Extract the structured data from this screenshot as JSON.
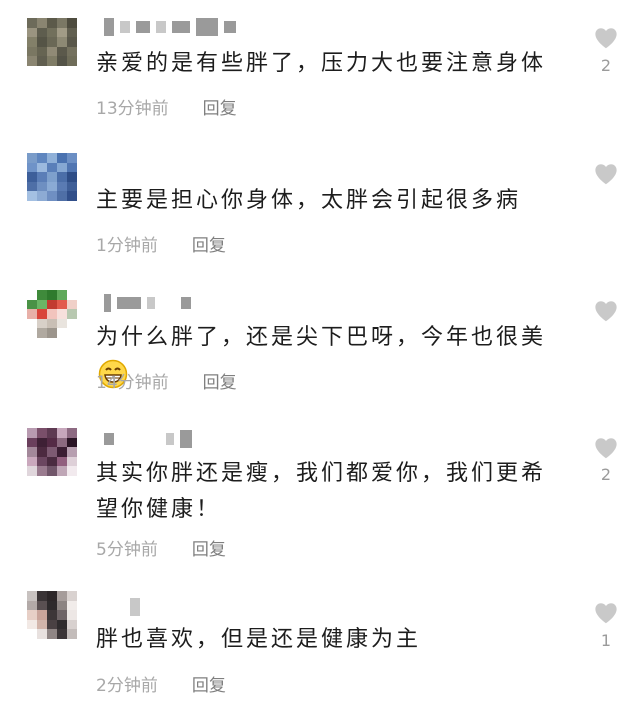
{
  "comments": [
    {
      "text": "亲爱的是有些胖了，压力大也要注意身体",
      "time": "13分钟前",
      "reply": "回复",
      "likes": "2",
      "avatar_colors": [
        "#6d6b5a",
        "#8a8571",
        "#5c5a4a",
        "#7b7865",
        "#4e4c3f",
        "#9a9480",
        "#5e5d4e",
        "#72705c",
        "#a19b86",
        "#615f50",
        "#838069",
        "#555446",
        "#6a6856",
        "#8d8974",
        "#59574a",
        "#7a7762",
        "#666452",
        "#908a76",
        "#5b594b",
        "#74715e",
        "#8a8571",
        "#605e4f",
        "#7f7c66",
        "#545347",
        "#6f6d59"
      ]
    },
    {
      "text": "主要是担心你身体，太胖会引起很多病",
      "time": "1分钟前",
      "reply": "回复",
      "likes": "",
      "avatar_colors": [
        "#7a9cc9",
        "#5f86bf",
        "#8fb0d8",
        "#4a72b0",
        "#6c8fc4",
        "#6f93c8",
        "#9bb9de",
        "#5a7fb9",
        "#86a8d3",
        "#5176b2",
        "#3d5f9a",
        "#5b7eb7",
        "#7ea0cc",
        "#4b6ea8",
        "#2e4d86",
        "#4e6fa7",
        "#6e8fc1",
        "#8aaad4",
        "#5a7bb3",
        "#3f5f98",
        "#a4c0e2",
        "#8dabd4",
        "#6f8fc2",
        "#4f6fa6",
        "#314f8a"
      ]
    },
    {
      "text": "为什么胖了，还是尖下巴呀，今年也很美",
      "time": "14分钟前",
      "reply": "回复",
      "likes": "",
      "avatar_colors": [
        "#ffffff",
        "#3f8a3b",
        "#2f7a2d",
        "#5fa85a",
        "#ffffff",
        "#4a9246",
        "#6bb565",
        "#c23b30",
        "#e25a4c",
        "#f0d0c8",
        "#e8b0a8",
        "#d9443a",
        "#f2c4bd",
        "#f7e0dc",
        "#b8c8b0",
        "#ffffff",
        "#d8d0c8",
        "#c9bfb5",
        "#e9e4de",
        "#ffffff",
        "#ffffff",
        "#b0a9a0",
        "#9c958c",
        "#ffffff",
        "#ffffff"
      ],
      "emoji": "grin-emoji"
    },
    {
      "text": "其实你胖还是瘦，我们都爱你，我们更希望你健康！",
      "time": "5分钟前",
      "reply": "回复",
      "likes": "2",
      "avatar_colors": [
        "#b89ab0",
        "#7a4f6a",
        "#5e3a52",
        "#c7a7bc",
        "#8d6a82",
        "#6a3f5c",
        "#3e2035",
        "#542a45",
        "#8c6a80",
        "#2a1525",
        "#a3889a",
        "#4c2a40",
        "#7d5a72",
        "#3b1e33",
        "#b79fb0",
        "#caa8bd",
        "#6b4660",
        "#4a2b40",
        "#915f7e",
        "#ded0d8",
        "#e0d6dc",
        "#9a7b8f",
        "#71566a",
        "#bfa6b6",
        "#f2eaee"
      ]
    },
    {
      "text": "胖也喜欢，但是还是健康为主",
      "time": "2分钟前",
      "reply": "回复",
      "likes": "1",
      "avatar_colors": [
        "#c8c2c0",
        "#3a3436",
        "#2c2628",
        "#a59c9a",
        "#d9d2d0",
        "#b3aaa8",
        "#5a5052",
        "#2e2a2c",
        "#8c8482",
        "#f1ecea",
        "#e7cfc6",
        "#c9a49a",
        "#3d3638",
        "#6e6466",
        "#ede7e5",
        "#f2e9e5",
        "#d2b5ab",
        "#4a4143",
        "#2f2b2d",
        "#d8d1cf",
        "#ffffff",
        "#e8e1df",
        "#8f8584",
        "#3b3537",
        "#c3bcba"
      ]
    }
  ],
  "colors": {
    "text": "#1d1d1d",
    "meta": "#a8a8a8",
    "reply": "#7f7f7f",
    "heart": "#c9c9c9",
    "count": "#9b9b9b"
  },
  "icons": {
    "like": "heart-icon",
    "username": "blurred-username"
  }
}
